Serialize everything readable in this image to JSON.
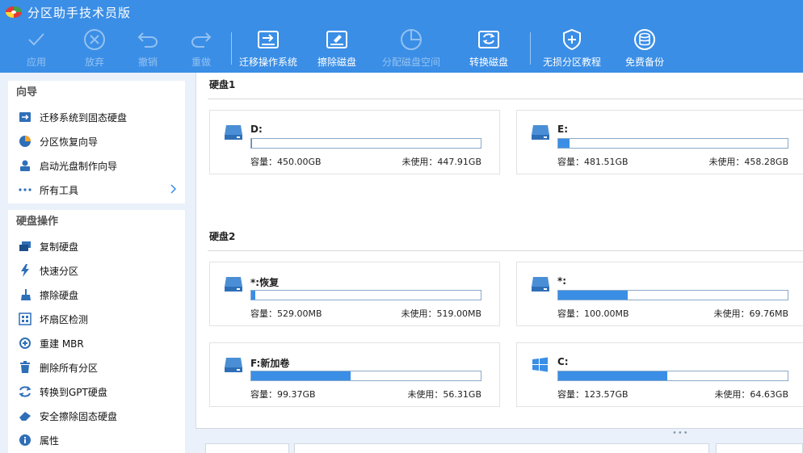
{
  "app": {
    "title": "分区助手技术员版"
  },
  "toolbar": {
    "apply": "应用",
    "discard": "放弃",
    "undo": "撤销",
    "redo": "重做",
    "migrate_os": "迁移操作系统",
    "wipe_disk": "擦除磁盘",
    "allocate_space": "分配磁盘空间",
    "convert_disk": "转换磁盘",
    "lossless_tutorial": "无损分区教程",
    "free_backup": "免费备份"
  },
  "sidebar": {
    "wizard_title": "向导",
    "wizard_items": [
      {
        "label": "迁移系统到固态硬盘",
        "icon": "migrate-ssd-icon"
      },
      {
        "label": "分区恢复向导",
        "icon": "partition-recovery-icon"
      },
      {
        "label": "启动光盘制作向导",
        "icon": "bootable-media-icon"
      },
      {
        "label": "所有工具",
        "icon": "more-dots-icon"
      }
    ],
    "disk_ops_title": "硬盘操作",
    "disk_ops_items": [
      {
        "label": "复制硬盘",
        "icon": "copy-disk-icon"
      },
      {
        "label": "快速分区",
        "icon": "lightning-icon"
      },
      {
        "label": "擦除硬盘",
        "icon": "broom-icon"
      },
      {
        "label": "坏扇区检测",
        "icon": "bad-sector-icon"
      },
      {
        "label": "重建 MBR",
        "icon": "rebuild-mbr-icon"
      },
      {
        "label": "删除所有分区",
        "icon": "trash-icon"
      },
      {
        "label": "转换到GPT硬盘",
        "icon": "convert-icon"
      },
      {
        "label": "安全擦除固态硬盘",
        "icon": "eraser-icon"
      },
      {
        "label": "属性",
        "icon": "info-icon"
      }
    ]
  },
  "disks": [
    {
      "title": "硬盘1",
      "partitions": [
        {
          "name": "D:",
          "capacity": "容量：450.00GB",
          "unused": "未使用：447.91GB",
          "used_fraction": 0.005,
          "icon": "drive-icon"
        },
        {
          "name": "E:",
          "capacity": "容量：481.51GB",
          "unused": "未使用：458.28GB",
          "used_fraction": 0.048,
          "icon": "drive-icon"
        }
      ]
    },
    {
      "title": "硬盘2",
      "partitions": [
        {
          "name": "*:恢复",
          "capacity": "容量：529.00MB",
          "unused": "未使用：519.00MB",
          "used_fraction": 0.019,
          "icon": "drive-icon"
        },
        {
          "name": "*:",
          "capacity": "容量：100.00MB",
          "unused": "未使用：69.76MB",
          "used_fraction": 0.302,
          "icon": "drive-icon"
        },
        {
          "name": "F:新加卷",
          "capacity": "容量：99.37GB",
          "unused": "未使用：56.31GB",
          "used_fraction": 0.433,
          "icon": "drive-icon"
        },
        {
          "name": "C:",
          "capacity": "容量：123.57GB",
          "unused": "未使用：64.63GB",
          "used_fraction": 0.477,
          "icon": "windows-icon"
        }
      ]
    }
  ],
  "colors": {
    "accent": "#3a8ee6",
    "bar_fill": "#3a8ee6",
    "sidebar_bg": "#eaf1fa"
  }
}
